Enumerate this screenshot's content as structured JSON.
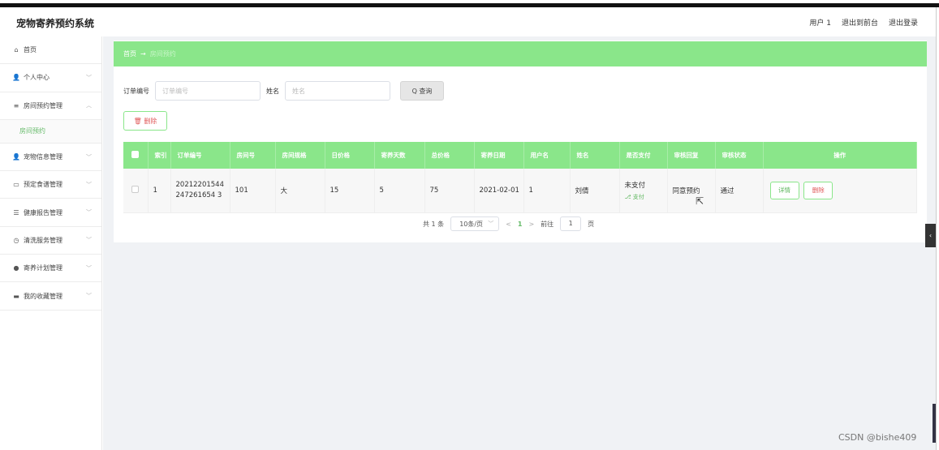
{
  "app": {
    "title": "宠物寄养预约系统"
  },
  "header": {
    "user": "用户 1",
    "back_front": "退出到前台",
    "logout": "退出登录"
  },
  "sidebar": {
    "items": [
      {
        "label": "首页",
        "icon": "home-icon",
        "glyph": "⌂"
      },
      {
        "label": "个人中心",
        "icon": "user-icon",
        "glyph": "👤"
      },
      {
        "label": "房间预约管理",
        "icon": "list-icon",
        "glyph": "≡"
      },
      {
        "label": "宠物信息管理",
        "icon": "user-icon",
        "glyph": "👤"
      },
      {
        "label": "预定食谱管理",
        "icon": "chat-icon",
        "glyph": "▭"
      },
      {
        "label": "健康报告管理",
        "icon": "sliders-icon",
        "glyph": "☰"
      },
      {
        "label": "清洗服务管理",
        "icon": "clock-icon",
        "glyph": "◷"
      },
      {
        "label": "寄养计划管理",
        "icon": "location-icon",
        "glyph": "●"
      },
      {
        "label": "我的收藏管理",
        "icon": "card-icon",
        "glyph": "▬"
      }
    ],
    "active_sub": "房间预约",
    "chevron_down": "﹀",
    "chevron_up": "︿"
  },
  "breadcrumb": {
    "home": "首页",
    "sep": "→",
    "current": "房间预约"
  },
  "search": {
    "order_label": "订单编号",
    "order_placeholder": "订单编号",
    "name_label": "姓名",
    "name_placeholder": "姓名",
    "query_label": "Q 查询"
  },
  "toolbar": {
    "delete_label": "🗑 删除"
  },
  "table": {
    "headers": [
      "索引",
      "订单编号",
      "房间号",
      "房间规格",
      "日价格",
      "寄养天数",
      "总价格",
      "寄养日期",
      "用户名",
      "姓名",
      "是否支付",
      "审核回复",
      "审核状态",
      "操作"
    ],
    "rows": [
      {
        "index": "1",
        "order_no": "20212201544247261654 3",
        "room_no": "101",
        "room_spec": "大",
        "day_price": "15",
        "days": "5",
        "total": "75",
        "date": "2021-02-01",
        "username": "1",
        "name": "刘倩",
        "paid": "未支付",
        "pay_link": "⎇ 支付",
        "reply": "同意预约",
        "status": "通过",
        "view_label": "详情",
        "del_label": "删除"
      }
    ]
  },
  "pager": {
    "total": "共 1 条",
    "size": "10条/页",
    "prev": "<",
    "page": "1",
    "next": ">",
    "goto": "前往",
    "goto_val": "1",
    "page_unit": "页"
  },
  "watermark": "CSDN @bishe409",
  "colors": {
    "accent": "#8ae68a",
    "danger": "#e05a5a",
    "link": "#5ab55a"
  }
}
